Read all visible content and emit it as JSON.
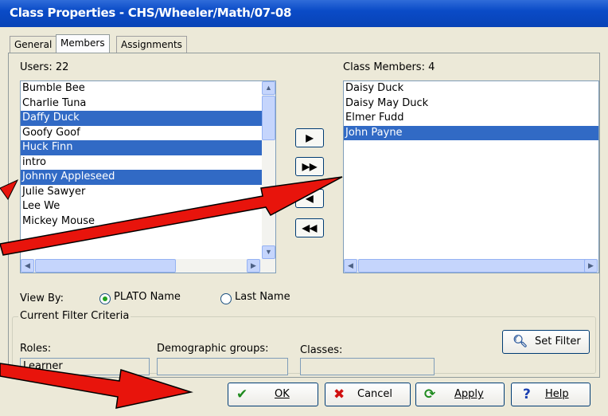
{
  "window": {
    "title": "Class Properties - CHS/Wheeler/Math/07-08"
  },
  "tabs": [
    {
      "label": "General",
      "active": false
    },
    {
      "label": "Members",
      "active": true
    },
    {
      "label": "Assignments",
      "active": false
    }
  ],
  "users": {
    "label": "Users: 22",
    "items": [
      {
        "name": "Bumble Bee",
        "selected": false
      },
      {
        "name": "Charlie Tuna",
        "selected": false
      },
      {
        "name": "Daffy Duck",
        "selected": true
      },
      {
        "name": "Goofy Goof",
        "selected": false
      },
      {
        "name": "Huck Finn",
        "selected": true
      },
      {
        "name": "intro",
        "selected": false
      },
      {
        "name": "Johnny Appleseed",
        "selected": true
      },
      {
        "name": "Julie Sawyer",
        "selected": false
      },
      {
        "name": "Lee We",
        "selected": false
      },
      {
        "name": "Mickey Mouse",
        "selected": false
      }
    ]
  },
  "members": {
    "label": "Class Members: 4",
    "items": [
      {
        "name": "Daisy Duck",
        "selected": false
      },
      {
        "name": "Daisy May Duck",
        "selected": false
      },
      {
        "name": "Elmer Fudd",
        "selected": false
      },
      {
        "name": "John Payne",
        "selected": true
      }
    ]
  },
  "move_buttons": {
    "add": "▶",
    "add_all": "▶▶",
    "remove": "◀",
    "remove_all": "◀◀"
  },
  "view_by": {
    "label": "View By:",
    "options": [
      {
        "label": "PLATO Name",
        "selected": true
      },
      {
        "label": "Last Name",
        "selected": false
      }
    ]
  },
  "filter": {
    "title": "Current Filter Criteria",
    "roles_label": "Roles:",
    "roles_value": "Learner",
    "demographic_label": "Demographic groups:",
    "demographic_value": "",
    "classes_label": "Classes:",
    "classes_value": "",
    "set_filter_label": "Set Filter"
  },
  "buttons": {
    "ok": "OK",
    "cancel": "Cancel",
    "apply": "Apply",
    "help": "Help"
  },
  "colors": {
    "title_bar": "#0a4bc7",
    "selection": "#316ac5",
    "annotation_arrow": "#e8140c"
  }
}
